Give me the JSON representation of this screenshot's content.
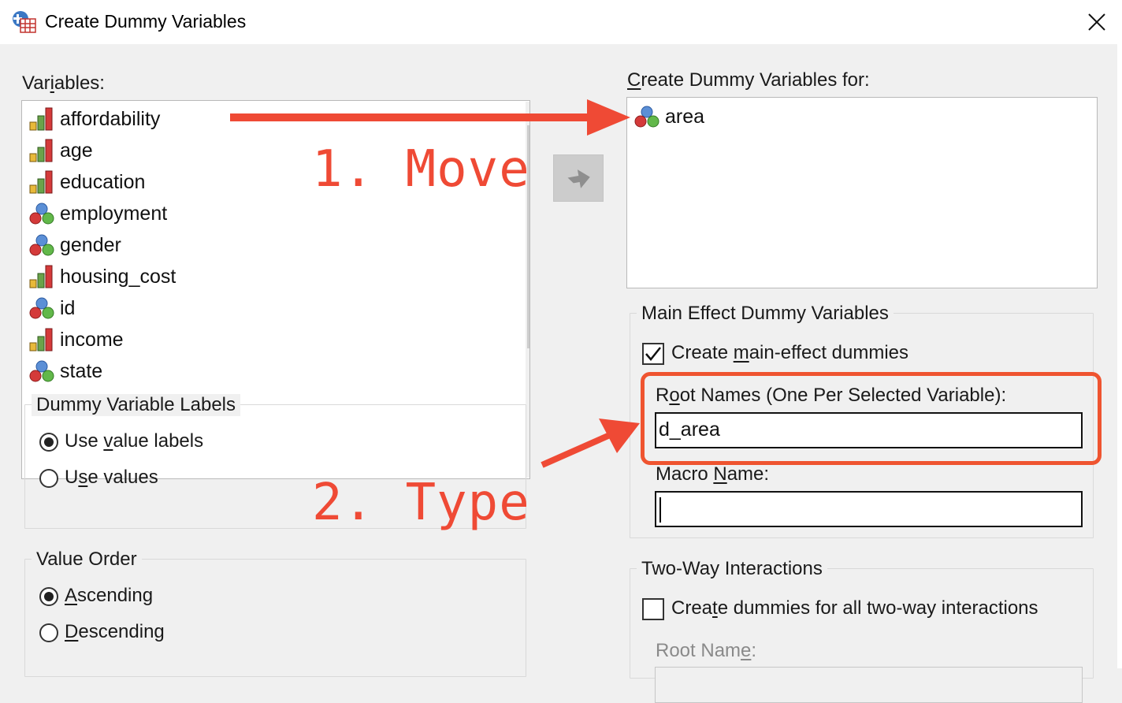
{
  "window": {
    "title": "Create Dummy Variables",
    "app_icon": "spss-table-icon",
    "close_icon": "close-icon"
  },
  "variables": {
    "label_pre": "Var",
    "label_u": "i",
    "label_post": "ables:",
    "items": [
      {
        "name": "affordability",
        "icon": "scale-measure-icon"
      },
      {
        "name": "age",
        "icon": "scale-measure-icon"
      },
      {
        "name": "education",
        "icon": "scale-measure-icon"
      },
      {
        "name": "employment",
        "icon": "nominal-measure-icon"
      },
      {
        "name": "gender",
        "icon": "nominal-measure-icon"
      },
      {
        "name": "housing_cost",
        "icon": "scale-measure-icon"
      },
      {
        "name": "id",
        "icon": "nominal-measure-icon"
      },
      {
        "name": "income",
        "icon": "scale-measure-icon"
      },
      {
        "name": "state",
        "icon": "nominal-measure-icon"
      }
    ]
  },
  "move_button": {
    "icon": "arrow-right-icon"
  },
  "target": {
    "label_u": "C",
    "label_post": "reate Dummy Variables for:",
    "items": [
      {
        "name": "area",
        "icon": "nominal-measure-icon"
      }
    ]
  },
  "dummy_labels": {
    "title": "Dummy Variable Labels",
    "options": [
      {
        "pre": "Use ",
        "u": "v",
        "post": "alue labels",
        "checked": true
      },
      {
        "pre": "U",
        "u": "s",
        "post": "e values",
        "checked": false
      }
    ]
  },
  "value_order": {
    "title": "Value Order",
    "options": [
      {
        "pre": "",
        "u": "A",
        "post": "scending",
        "checked": true
      },
      {
        "pre": "",
        "u": "D",
        "post": "escending",
        "checked": false
      }
    ]
  },
  "main_effect": {
    "title": "Main Effect Dummy Variables",
    "checkbox": {
      "pre": "Create ",
      "u": "m",
      "post": "ain-effect dummies",
      "checked": true
    },
    "root_label": {
      "pre": "R",
      "u": "o",
      "post": "ot Names (One Per Selected Variable):"
    },
    "root_value": "d_area",
    "macro_label": {
      "pre": "Macro ",
      "u": "N",
      "post": "ame:"
    },
    "macro_value": ""
  },
  "two_way": {
    "title": "Two-Way Interactions",
    "checkbox": {
      "pre": "Crea",
      "u": "t",
      "post": "e dummies for all two-way interactions",
      "checked": false
    },
    "root_label": {
      "pre": "Root Nam",
      "u": "e",
      "post": ":"
    }
  },
  "annotations": {
    "step1": "1. Move",
    "step2": "2. Type",
    "color": "#ef4a35"
  }
}
